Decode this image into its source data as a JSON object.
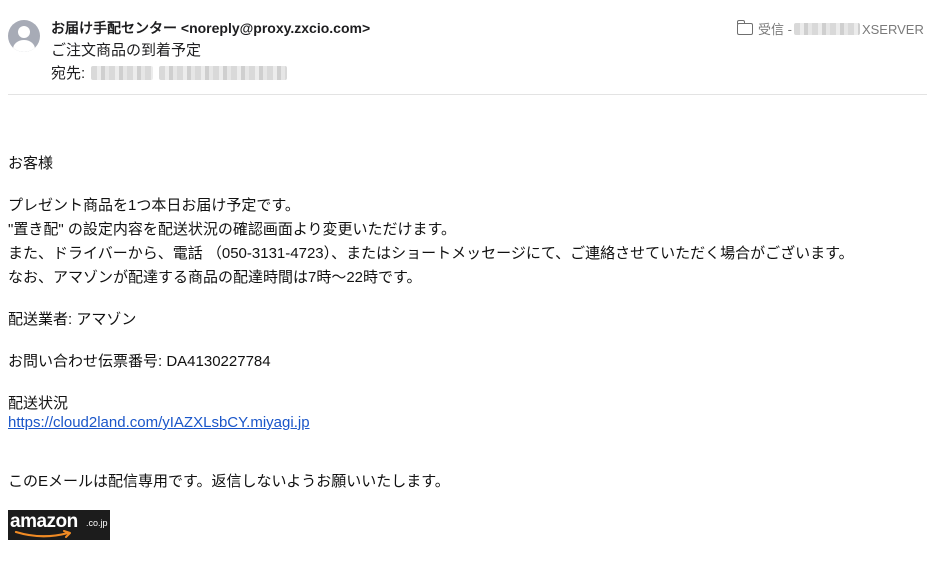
{
  "header": {
    "sender": "お届け手配センター <noreply@proxy.zxcio.com>",
    "subject": "ご注文商品の到着予定",
    "to_label": "宛先:",
    "mailbox_prefix": "受信 -",
    "mailbox_suffix": "XSERVER"
  },
  "body": {
    "greeting": "お客様",
    "line1": "プレゼント商品を1つ本日お届け予定です。",
    "line2": "\"置き配\" の設定内容を配送状況の確認画面より変更いただけます。",
    "line3": "また、ドライバーから、電話 （050-3131-4723）、またはショートメッセージにて、ご連絡させていただく場合がございます。",
    "line4": "なお、アマゾンが配達する商品の配達時間は7時〜22時です。",
    "carrier": "配送業者: アマゾン",
    "tracking": "お問い合わせ伝票番号: DA4130227784",
    "status_label": "配送状況",
    "link": "https://cloud2land.com/yIAZXLsbCY.miyagi.jp",
    "footer": "このEメールは配信専用です。返信しないようお願いいたします。"
  },
  "logo": {
    "word": "amazon",
    "tld": ".co.jp",
    "bg_color": "#1c1c1c",
    "smile_color": "#f08a24"
  },
  "icons": {
    "avatar": "person-avatar-icon",
    "folder": "folder-icon"
  }
}
